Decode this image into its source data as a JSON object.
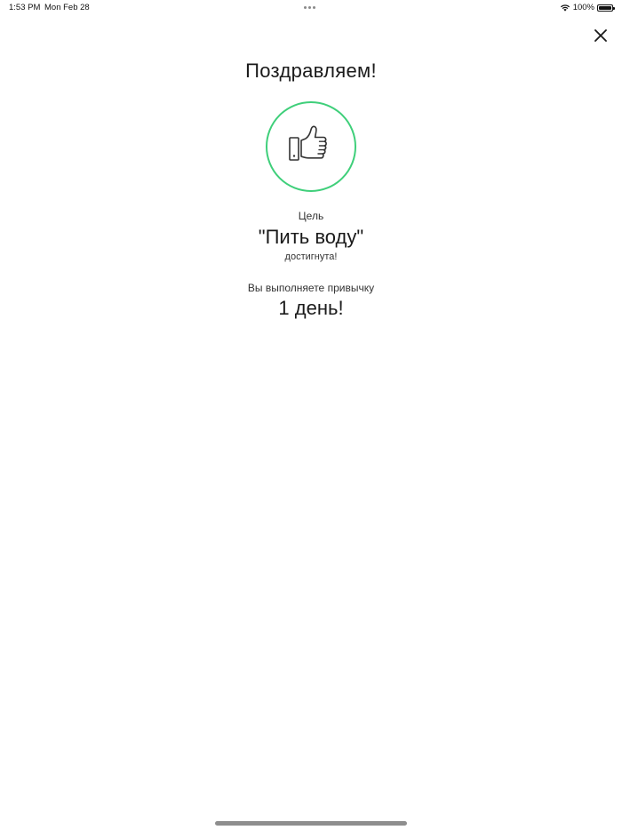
{
  "status_bar": {
    "time": "1:53 PM",
    "date": "Mon Feb 28",
    "battery": "100%"
  },
  "icons": {
    "close": "close-icon",
    "badge": "thumbs-up-icon",
    "wifi": "wifi-icon",
    "battery": "battery-icon"
  },
  "colors": {
    "accent": "#3fcf7a",
    "text": "#1a1a1a"
  },
  "main": {
    "title": "Поздравляем!",
    "goal_caption": "Цель",
    "goal_name": "\"Пить воду\"",
    "goal_status": "достигнута!",
    "streak_caption": "Вы выполняете привычку",
    "streak_value": "1 день!"
  }
}
